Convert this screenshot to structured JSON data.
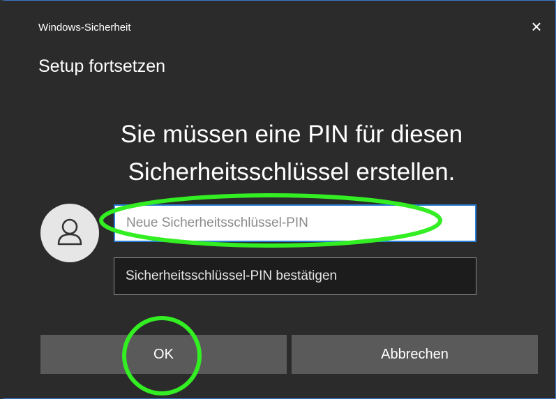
{
  "window": {
    "app_title": "Windows-Sicherheit",
    "close_symbol": "×"
  },
  "dialog": {
    "subtitle": "Setup fortsetzen",
    "heading_line1": "Sie müssen eine PIN für diesen",
    "heading_line2": "Sicherheitsschlüssel erstellen."
  },
  "form": {
    "new_pin_placeholder": "Neue Sicherheitsschlüssel-PIN",
    "confirm_pin_placeholder": "Sicherheitsschlüssel-PIN bestätigen",
    "avatar_icon": "user-icon"
  },
  "buttons": {
    "ok_label": "OK",
    "cancel_label": "Abbrechen"
  },
  "colors": {
    "background": "#2b2b2b",
    "accent_border": "#3a78c8",
    "annotation": "#33ee22"
  }
}
